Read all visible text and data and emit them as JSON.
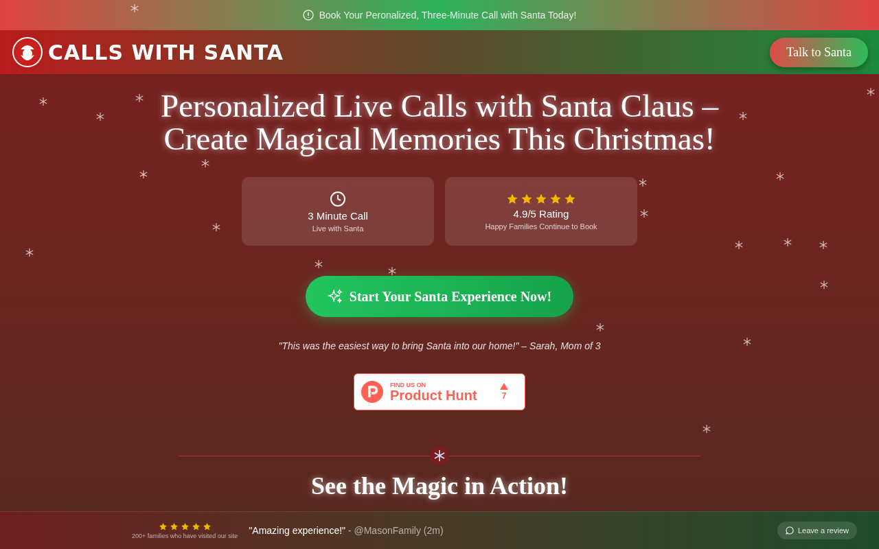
{
  "announcement": {
    "text": "Book Your Peronalized, Three-Minute Call with Santa Today!"
  },
  "header": {
    "logo_text": "CALLS WITH SANTA",
    "cta": "Talk to Santa"
  },
  "hero": {
    "title_lines": [
      "Personalized Live Calls with Santa Claus –",
      "Create Magical Memories This Christmas!"
    ],
    "stats": [
      {
        "kind": "clock",
        "title": "3 Minute Call",
        "subtitle": "Live with Santa"
      },
      {
        "kind": "stars",
        "stars": 5,
        "title": "4.9/5 Rating",
        "subtitle": "Happy Families Continue to Book"
      }
    ],
    "cta": "Start Your Santa Experience Now!",
    "testimonial": "\"This was the easiest way to bring Santa into our home!\" – Sarah, Mom of 3",
    "product_hunt": {
      "eyebrow": "FIND US ON",
      "name": "Product Hunt",
      "votes": "7"
    }
  },
  "section": {
    "title": "See the Magic in Action!"
  },
  "footer": {
    "stars": 5,
    "visitors": "200+ families who have visited our site",
    "quote": "\"Amazing experience!\"",
    "author": "- @MasonFamily (2m)",
    "review_button": "Leave a review"
  }
}
